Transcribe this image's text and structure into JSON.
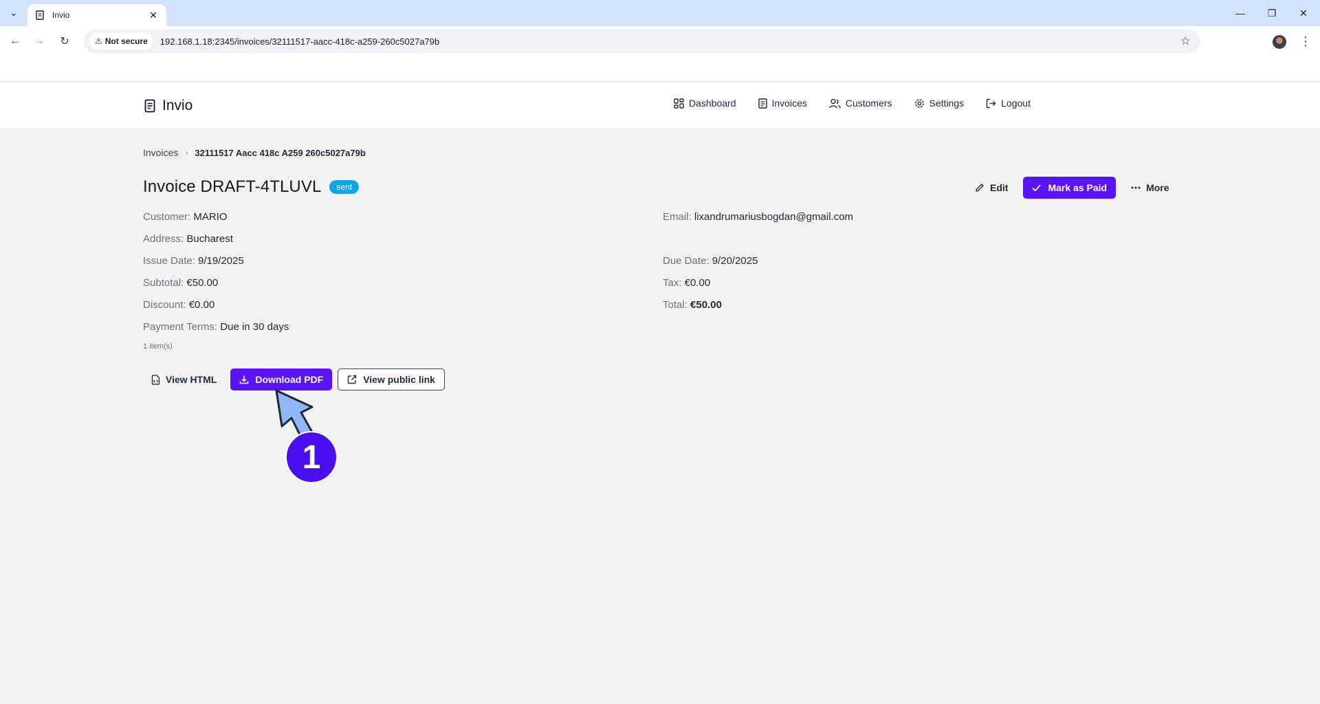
{
  "browser": {
    "tab_title": "Invio",
    "security_label": "Not secure",
    "url": "192.168.1.18:2345/invoices/32111517-aacc-418c-a259-260c5027a79b"
  },
  "app": {
    "brand": "Invio",
    "nav": [
      {
        "label": "Dashboard",
        "icon": "dashboard-icon"
      },
      {
        "label": "Invoices",
        "icon": "invoice-icon"
      },
      {
        "label": "Customers",
        "icon": "users-icon"
      },
      {
        "label": "Settings",
        "icon": "gear-icon"
      },
      {
        "label": "Logout",
        "icon": "logout-icon"
      }
    ]
  },
  "breadcrumb": {
    "root": "Invoices",
    "current": "32111517 Aacc 418c A259 260c5027a79b"
  },
  "invoice": {
    "title": "Invoice DRAFT-4TLUVL",
    "status": "sent",
    "customer_label": "Customer:",
    "customer": "MARIO",
    "email_label": "Email:",
    "email": "lixandrumariusbogdan@gmail.com",
    "address_label": "Address:",
    "address": "Bucharest",
    "issue_date_label": "Issue Date:",
    "issue_date": "9/19/2025",
    "due_date_label": "Due Date:",
    "due_date": "9/20/2025",
    "subtotal_label": "Subtotal:",
    "subtotal": "€50.00",
    "tax_label": "Tax:",
    "tax": "€0.00",
    "discount_label": "Discount:",
    "discount": "€0.00",
    "total_label": "Total:",
    "total": "€50.00",
    "payment_terms_label": "Payment Terms:",
    "payment_terms": "Due in 30 days",
    "items_count": "1 item(s)"
  },
  "actions": {
    "edit": "Edit",
    "mark_paid": "Mark as Paid",
    "more": "More",
    "view_html": "View HTML",
    "download_pdf": "Download PDF",
    "view_public_link": "View public link"
  },
  "annotation": {
    "step": "1"
  },
  "colors": {
    "primary": "#5b14f5",
    "badge": "#0ea5e9",
    "annotation_arrow": "#8fb6f7",
    "annotation_circle": "#4a0ff0"
  }
}
